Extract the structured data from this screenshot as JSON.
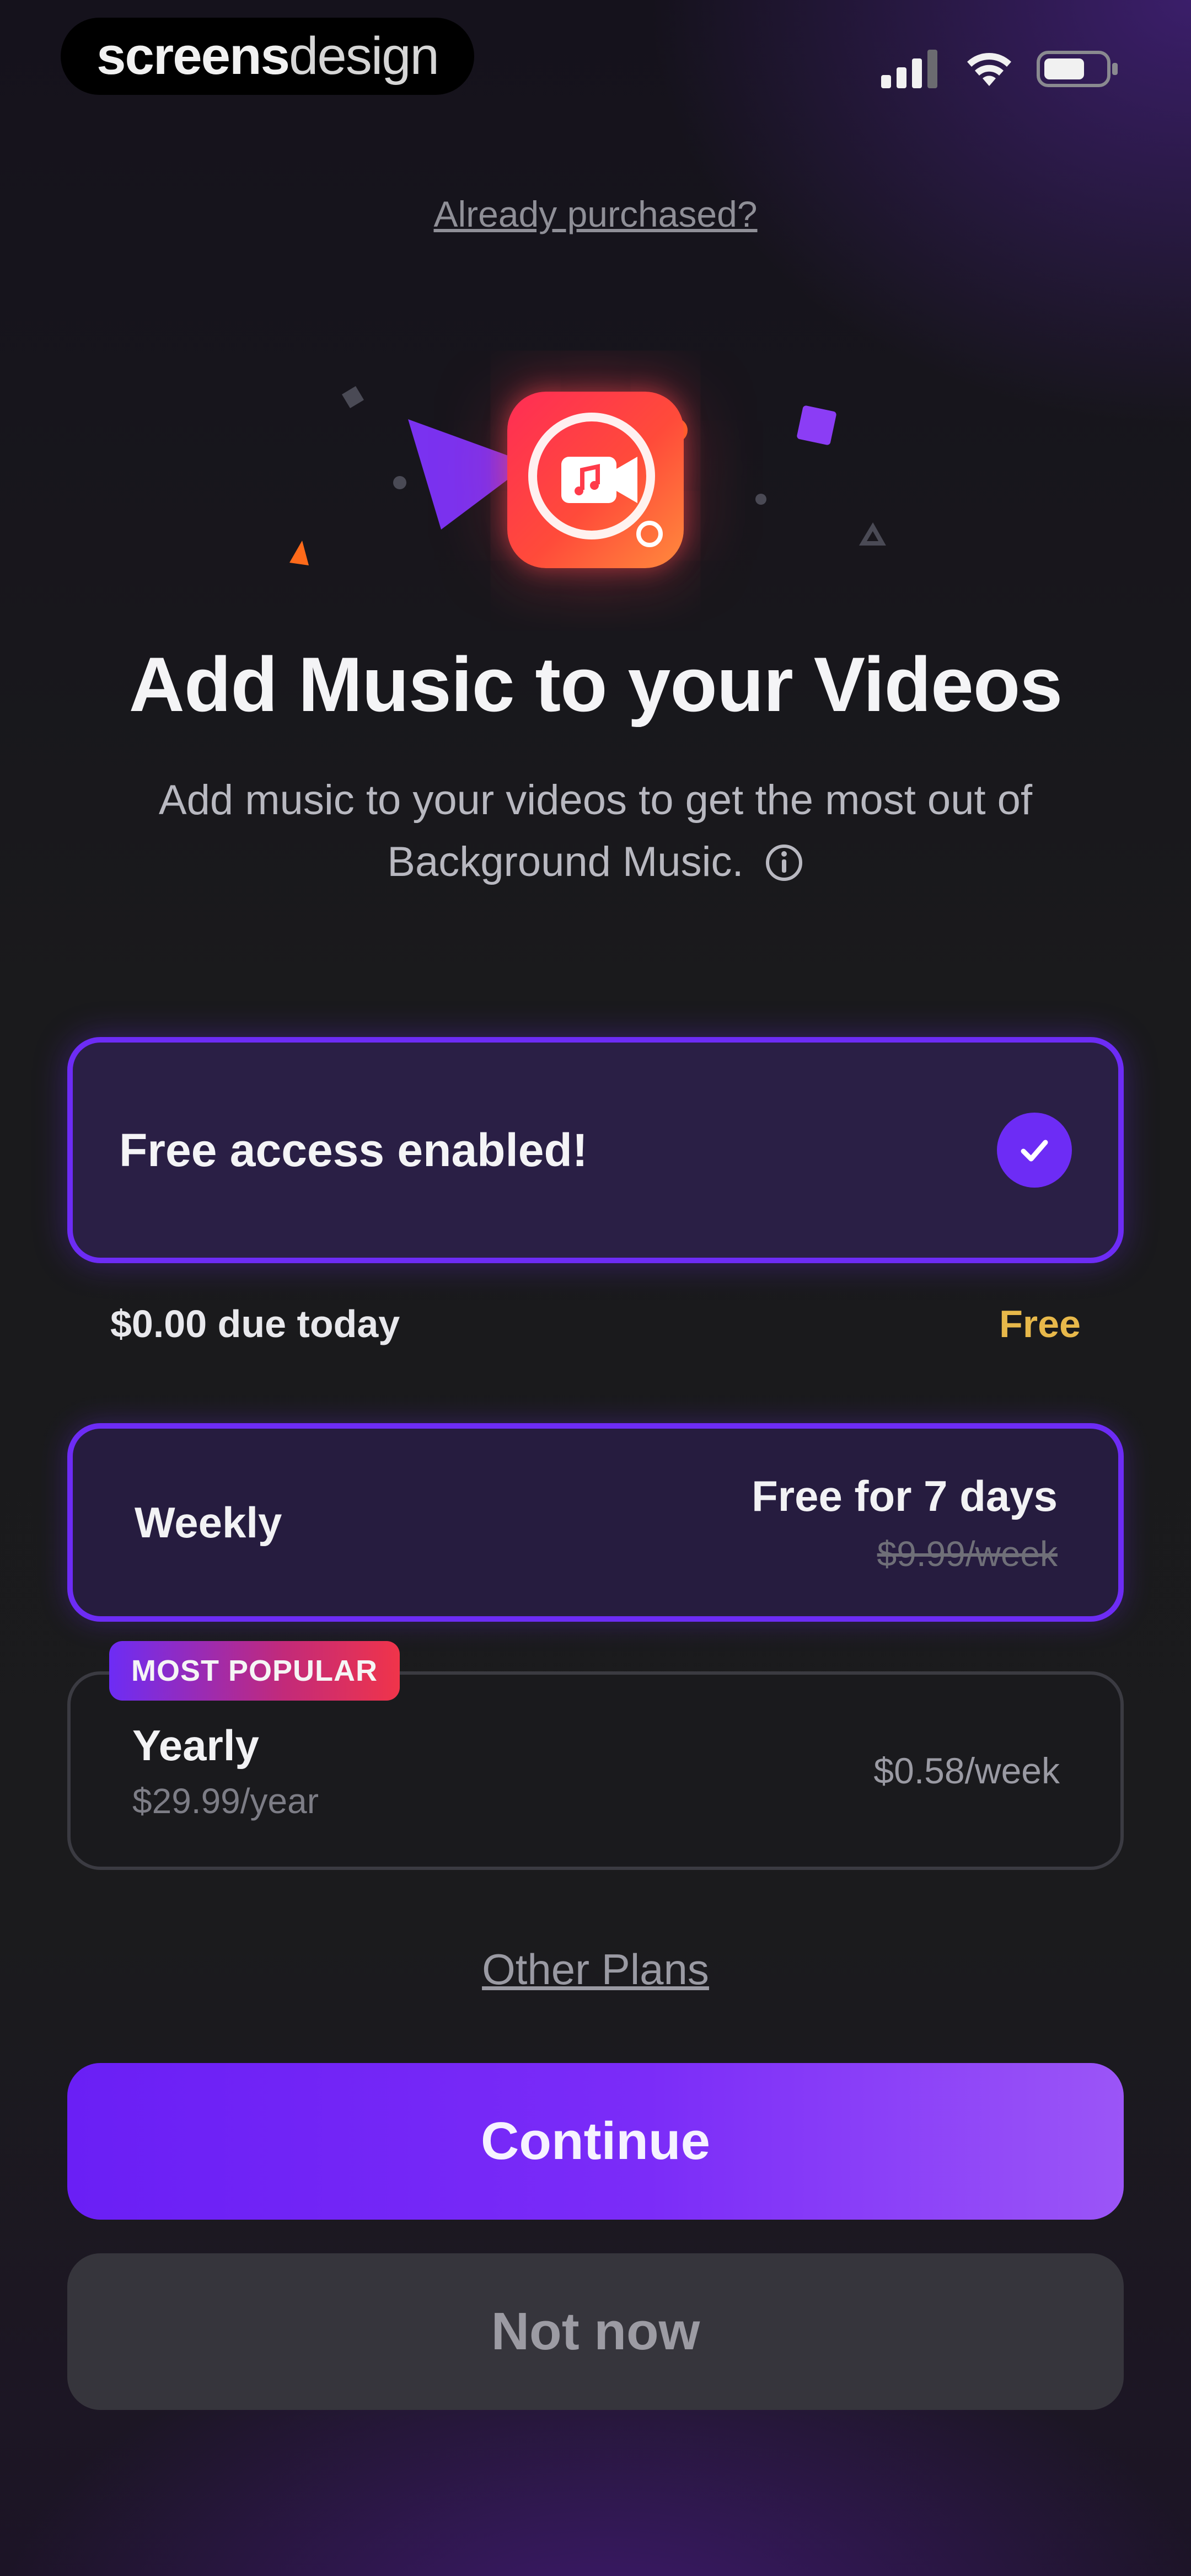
{
  "status_bar": {
    "brand_bold": "screens",
    "brand_light": "design"
  },
  "header": {
    "already_purchased": "Already purchased?"
  },
  "hero": {
    "title": "Add Music to your Videos",
    "subtitle": "Add music to your videos to get the most out of Background Music.",
    "info_icon": "info-icon"
  },
  "free_access": {
    "label": "Free access enabled!",
    "checked": true
  },
  "due": {
    "label": "$0.00 due today",
    "value": "Free"
  },
  "plans": [
    {
      "name": "Weekly",
      "price_main": "Free for 7 days",
      "price_strike": "$9.99/week",
      "selected": true
    },
    {
      "badge": "MOST POPULAR",
      "name": "Yearly",
      "sub": "$29.99/year",
      "price_week": "$0.58/week",
      "selected": false
    }
  ],
  "links": {
    "other_plans": "Other Plans"
  },
  "buttons": {
    "continue": "Continue",
    "not_now": "Not now"
  },
  "colors": {
    "accent": "#6d2cf5",
    "free_text": "#e7b84a",
    "badge_start": "#6d2cf5",
    "badge_end": "#f0344a"
  }
}
